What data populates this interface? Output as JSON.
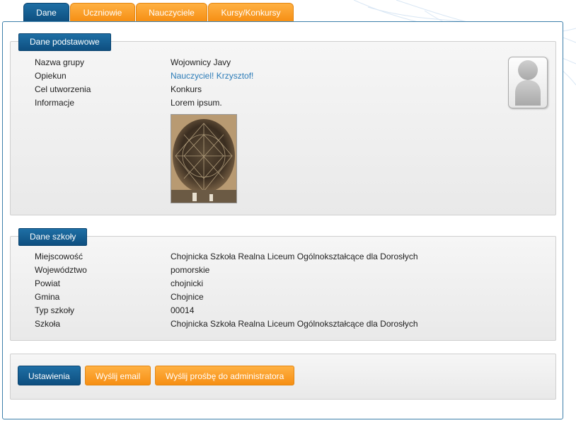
{
  "tabs": [
    {
      "label": "Dane",
      "active": true
    },
    {
      "label": "Uczniowie",
      "active": false
    },
    {
      "label": "Nauczyciele",
      "active": false
    },
    {
      "label": "Kursy/Konkursy",
      "active": false
    }
  ],
  "basic": {
    "header": "Dane podstawowe",
    "rows": [
      {
        "label": "Nazwa grupy",
        "value": "Wojownicy Javy"
      },
      {
        "label": "Opiekun",
        "value": "Nauczyciel! Krzysztof!"
      },
      {
        "label": "Cel utworzenia",
        "value": "Konkurs"
      },
      {
        "label": "Informacje",
        "value": "Lorem ipsum."
      }
    ]
  },
  "school": {
    "header": "Dane szkoły",
    "rows": [
      {
        "label": "Miejscowość",
        "value": "Chojnicka Szkoła Realna Liceum Ogólnokształcące dla Dorosłych"
      },
      {
        "label": "Województwo",
        "value": "pomorskie"
      },
      {
        "label": "Powiat",
        "value": "chojnicki"
      },
      {
        "label": "Gmina",
        "value": "Chojnice"
      },
      {
        "label": "Typ szkoły",
        "value": "00014"
      },
      {
        "label": "Szkoła",
        "value": "Chojnicka Szkoła Realna Liceum Ogólnokształcące dla Dorosłych"
      }
    ]
  },
  "actions": {
    "settings": "Ustawienia",
    "send_email": "Wyślij email",
    "send_request": "Wyślij prośbę do administratora"
  },
  "colors": {
    "accent_blue": "#0e4f80",
    "accent_orange": "#f68f14",
    "link": "#2c7cb8"
  }
}
